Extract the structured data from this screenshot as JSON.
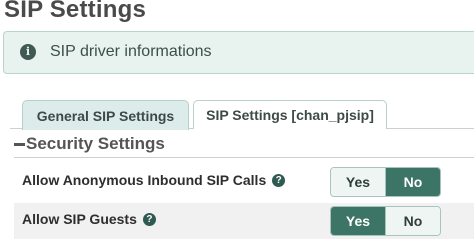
{
  "page": {
    "title": "SIP Settings"
  },
  "info": {
    "text": "SIP driver informations",
    "icon": "info-circle-icon"
  },
  "tabs": [
    {
      "label": "General SIP Settings",
      "active": true
    },
    {
      "label": "SIP Settings [chan_pjsip]",
      "active": false
    }
  ],
  "section": {
    "heading": "Security Settings"
  },
  "settings": [
    {
      "label": "Allow Anonymous Inbound SIP Calls",
      "yes": "Yes",
      "no": "No",
      "selected": "No"
    },
    {
      "label": "Allow SIP Guests",
      "yes": "Yes",
      "no": "No",
      "selected": "Yes"
    }
  ],
  "colors": {
    "accent": "#3c7565",
    "info_bg": "#e8f3f0",
    "tab_active_bg": "#dcecea"
  }
}
